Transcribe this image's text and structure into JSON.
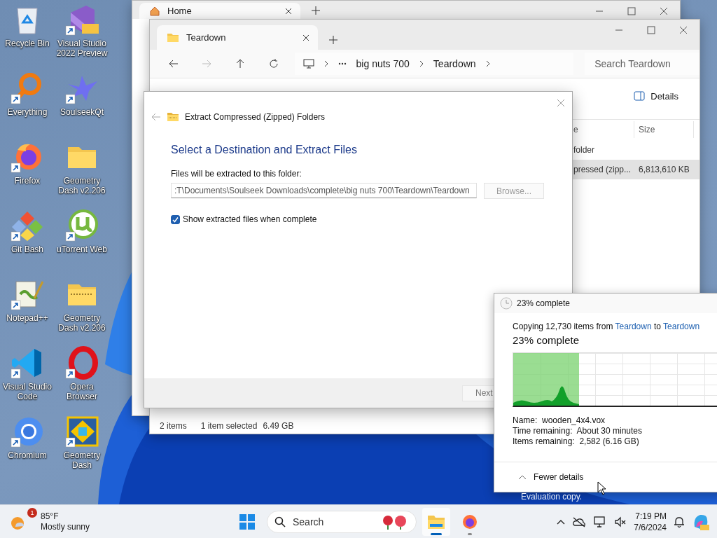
{
  "desktop_icons": [
    {
      "label": "Recycle Bin"
    },
    {
      "label": "Visual Studio 2022 Preview"
    },
    {
      "label": "Everything"
    },
    {
      "label": "SoulseekQt"
    },
    {
      "label": "Firefox"
    },
    {
      "label": "Geometry Dash v2.206"
    },
    {
      "label": "Git Bash"
    },
    {
      "label": "uTorrent Web"
    },
    {
      "label": "Notepad++"
    },
    {
      "label": "Geometry Dash v2.206"
    },
    {
      "label": "Visual Studio Code"
    },
    {
      "label": "Opera Browser"
    },
    {
      "label": "Chromium"
    },
    {
      "label": "Geometry Dash"
    }
  ],
  "back_explorer": {
    "tabs": [
      {
        "label": "Home",
        "selected": true
      }
    ]
  },
  "explorer": {
    "tabs": [
      {
        "label": "Teardown",
        "selected": true
      }
    ],
    "breadcrumb": [
      "big nuts 700",
      "Teardown"
    ],
    "search": {
      "placeholder": "Search Teardown"
    },
    "details_button": "Details",
    "columns": [
      "e",
      "Size"
    ],
    "rows": [
      {
        "cells": [
          "folder"
        ],
        "selected": false
      },
      {
        "cells": [
          "pressed (zipp...",
          "6,813,610 KB"
        ],
        "selected": true
      }
    ],
    "status_bar": {
      "item_count": "2 items",
      "selection": "1 item selected",
      "size": "6.49 GB"
    }
  },
  "extract_dialog": {
    "title": "Extract Compressed (Zipped) Folders",
    "heading": "Select a Destination and Extract Files",
    "field_label": "Files will be extracted to this folder:",
    "path_value": ":T\\Documents\\Soulseek Downloads\\complete\\big nuts 700\\Teardown\\Teardown",
    "browse_button": {
      "label": "Browse...",
      "disabled": true
    },
    "show_files": {
      "label": "Show extracted files when complete",
      "checked": true
    },
    "next_button": "Next"
  },
  "copy_progress": {
    "title": "23% complete",
    "summary": {
      "prefix": "Copying 12,730 items from",
      "source": "Teardown",
      "middle": "to",
      "destination": "Teardown"
    },
    "percent": "23% complete",
    "level": 0.23,
    "details": [
      {
        "label": "Name:",
        "value": "wooden_4x4.vox"
      },
      {
        "label": "Time remaining:",
        "value": "About 30 minutes"
      },
      {
        "label": "Items remaining:",
        "value": "2,582 (6.16 GB)"
      }
    ],
    "toggle": {
      "label": "Fewer details",
      "expanded": true
    }
  },
  "evaluation_notice": "Evaluation copy.",
  "taskbar": {
    "weather": {
      "badge": "1",
      "temperature": "85°F",
      "condition": "Mostly sunny"
    },
    "search": {
      "placeholder": "Search"
    },
    "apps": [
      {
        "active": true
      },
      {
        "active": false
      }
    ],
    "clock": {
      "time": "7:19 PM",
      "date": "7/6/2024"
    }
  }
}
